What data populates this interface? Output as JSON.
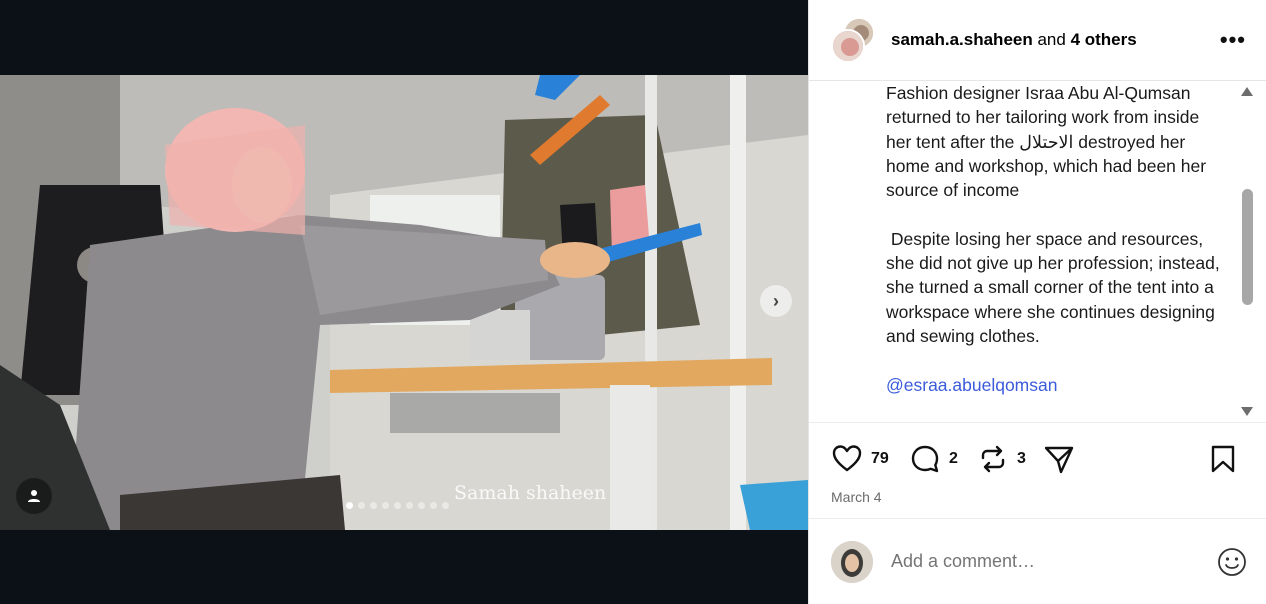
{
  "post": {
    "owner": "samah.a.shaheen",
    "and_text": " and ",
    "others": "4 others",
    "more_icon": "more-horizontal-icon",
    "photo_watermark": "Samah shaheen",
    "carousel_total": 9,
    "carousel_active": 1,
    "caption_text": "Fashion designer Israa Abu Al-Qumsan returned to her tailoring work from inside her tent after the الاحتلال destroyed her home and workshop, which had been her source of income\n\n Despite losing her space and resources, she did not give up her profession; instead, she turned a small corner of the tent into a workspace where she continues designing and sewing clothes.\n\n",
    "mention": "@esraa.abuelqomsan",
    "likes": "79",
    "comments": "2",
    "reposts": "3",
    "date": "March 4"
  },
  "composer": {
    "placeholder": "Add a comment…"
  },
  "colors": {
    "media_bg": "#0b1116",
    "mention": "#3b5bdb",
    "muted": "#6b6b6b"
  }
}
